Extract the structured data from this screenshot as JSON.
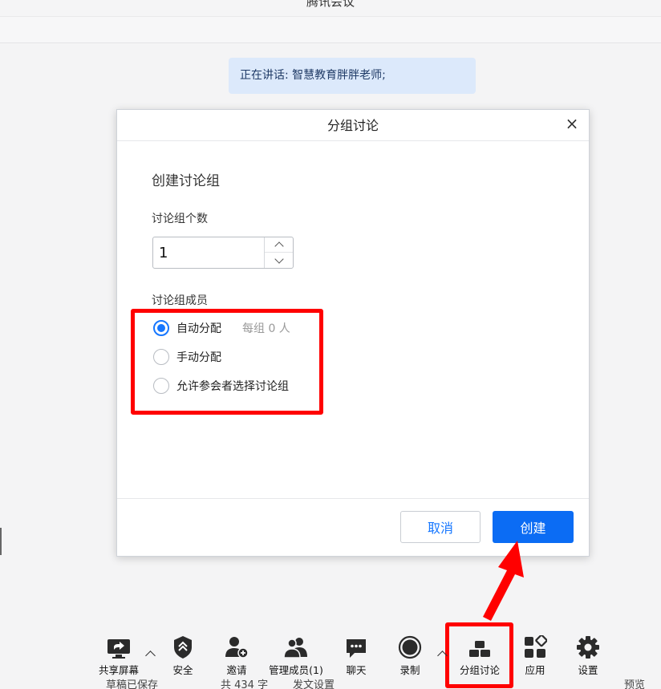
{
  "window": {
    "title": "腾讯会议"
  },
  "speaking": {
    "text": "正在讲话: 智慧教育胖胖老师;"
  },
  "dialog": {
    "title": "分组讨论",
    "close_label": "×",
    "section_title": "创建讨论组",
    "count_label": "讨论组个数",
    "count_value": "1",
    "members_label": "讨论组成员",
    "options": [
      {
        "label": "自动分配",
        "hint": "每组 0 人",
        "checked": true
      },
      {
        "label": "手动分配",
        "checked": false
      },
      {
        "label": "允许参会者选择讨论组",
        "checked": false
      }
    ],
    "cancel_label": "取消",
    "create_label": "创建"
  },
  "toolbar": {
    "items": [
      {
        "label": "共享屏幕",
        "icon": "share-screen-icon"
      },
      {
        "label": "安全",
        "icon": "shield-icon"
      },
      {
        "label": "邀请",
        "icon": "invite-user-icon"
      },
      {
        "label": "管理成员(1)",
        "icon": "members-icon"
      },
      {
        "label": "聊天",
        "icon": "chat-icon"
      },
      {
        "label": "录制",
        "icon": "record-icon"
      },
      {
        "label": "分组讨论",
        "icon": "breakout-icon"
      },
      {
        "label": "应用",
        "icon": "apps-icon"
      },
      {
        "label": "设置",
        "icon": "gear-icon"
      }
    ]
  },
  "statusbar": {
    "saved": "草稿已保存",
    "count": "共 434 字",
    "settings": "发文设置",
    "preview": "预览"
  },
  "annotation_color": "#ff0000",
  "accent_color": "#1677ff"
}
